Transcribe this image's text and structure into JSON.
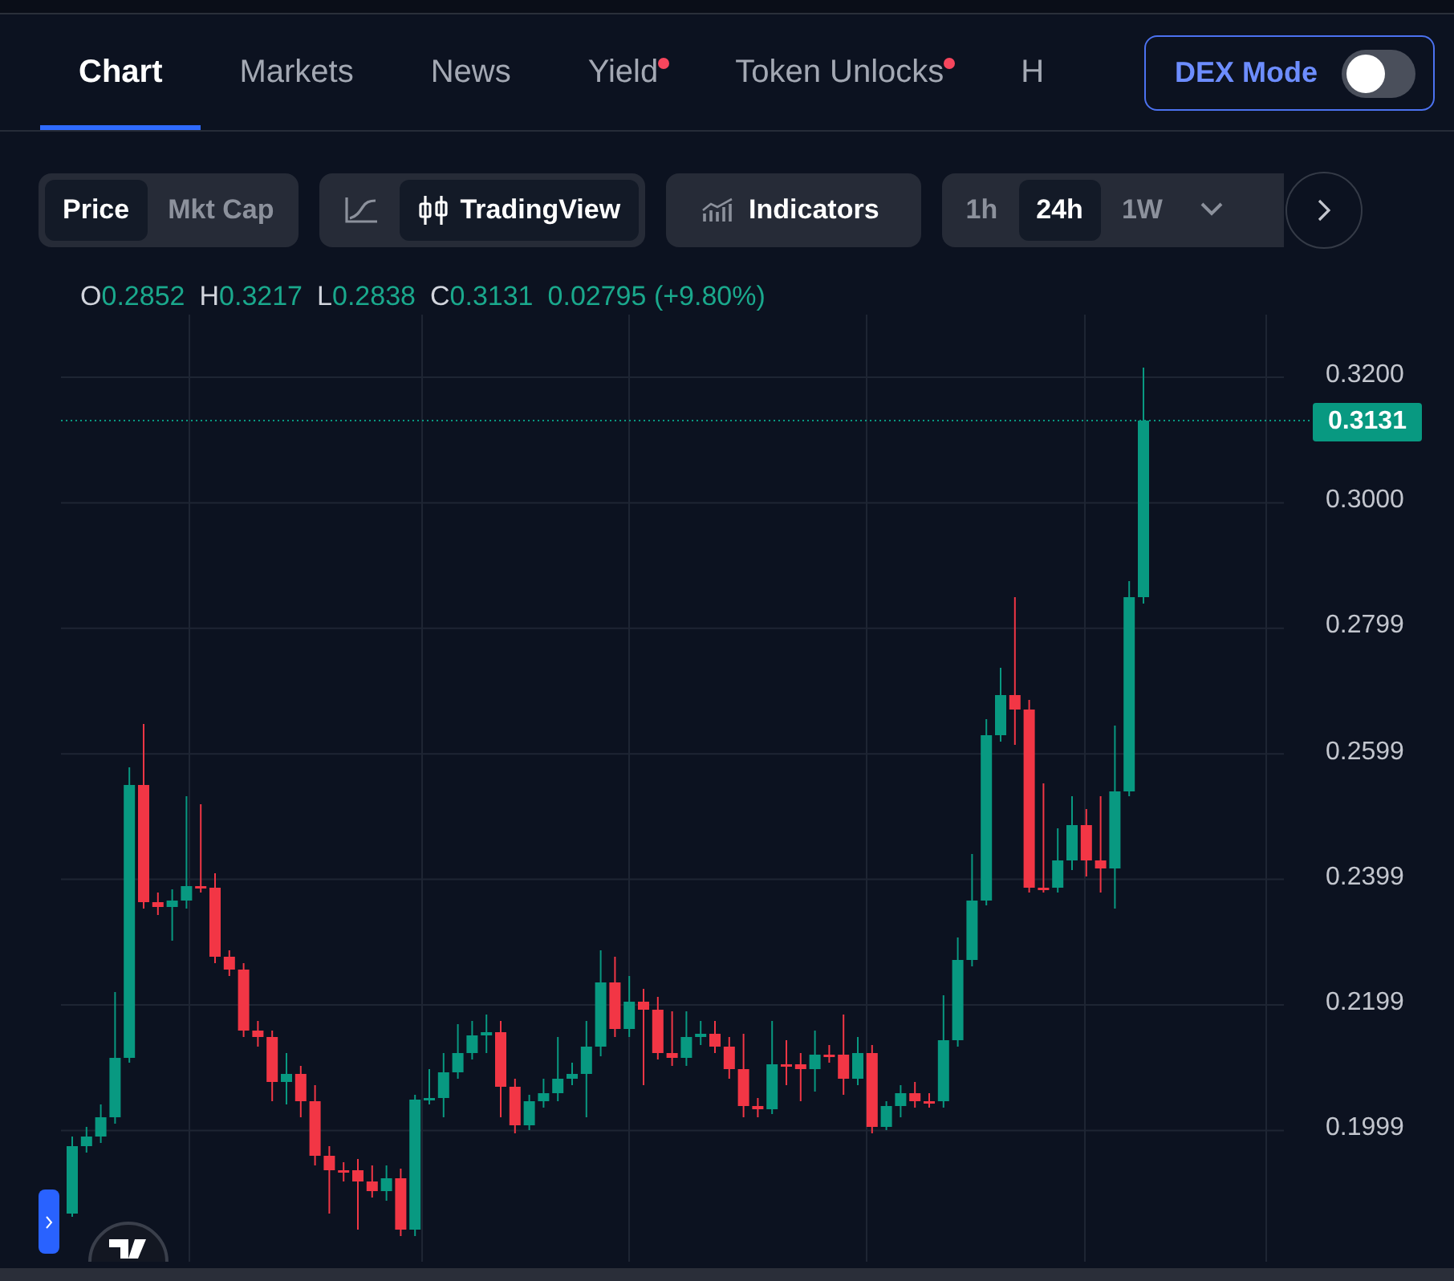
{
  "tabs": [
    {
      "label": "Chart",
      "selected": true,
      "dot": false
    },
    {
      "label": "Markets",
      "selected": false,
      "dot": false
    },
    {
      "label": "News",
      "selected": false,
      "dot": false
    },
    {
      "label": "Yield",
      "selected": false,
      "dot": true
    },
    {
      "label": "Token Unlocks",
      "selected": false,
      "dot": true
    },
    {
      "label": "H",
      "selected": false,
      "dot": false
    }
  ],
  "dex_mode": {
    "label": "DEX Mode",
    "on": false
  },
  "toolbar": {
    "value_type": [
      {
        "label": "Price",
        "selected": true
      },
      {
        "label": "Mkt Cap",
        "selected": false
      }
    ],
    "chart_style": [
      {
        "kind": "line",
        "selected": false
      },
      {
        "kind": "candles",
        "label": "TradingView",
        "selected": true
      }
    ],
    "indicators": {
      "label": "Indicators"
    },
    "timeframes": [
      {
        "label": "1h",
        "selected": false
      },
      {
        "label": "24h",
        "selected": true
      },
      {
        "label": "1W",
        "selected": false
      }
    ]
  },
  "ohlc": [
    {
      "key": "O",
      "value": "0.2852"
    },
    {
      "key": "H",
      "value": "0.3217"
    },
    {
      "key": "L",
      "value": "0.2838"
    },
    {
      "key": "C",
      "value": "0.3131"
    }
  ],
  "change": "0.02795 (+9.80%)",
  "price_axis": [
    "0.3200",
    "0.3000",
    "0.2799",
    "0.2599",
    "0.2399",
    "0.2199",
    "0.1999"
  ],
  "last_price": "0.3131"
}
